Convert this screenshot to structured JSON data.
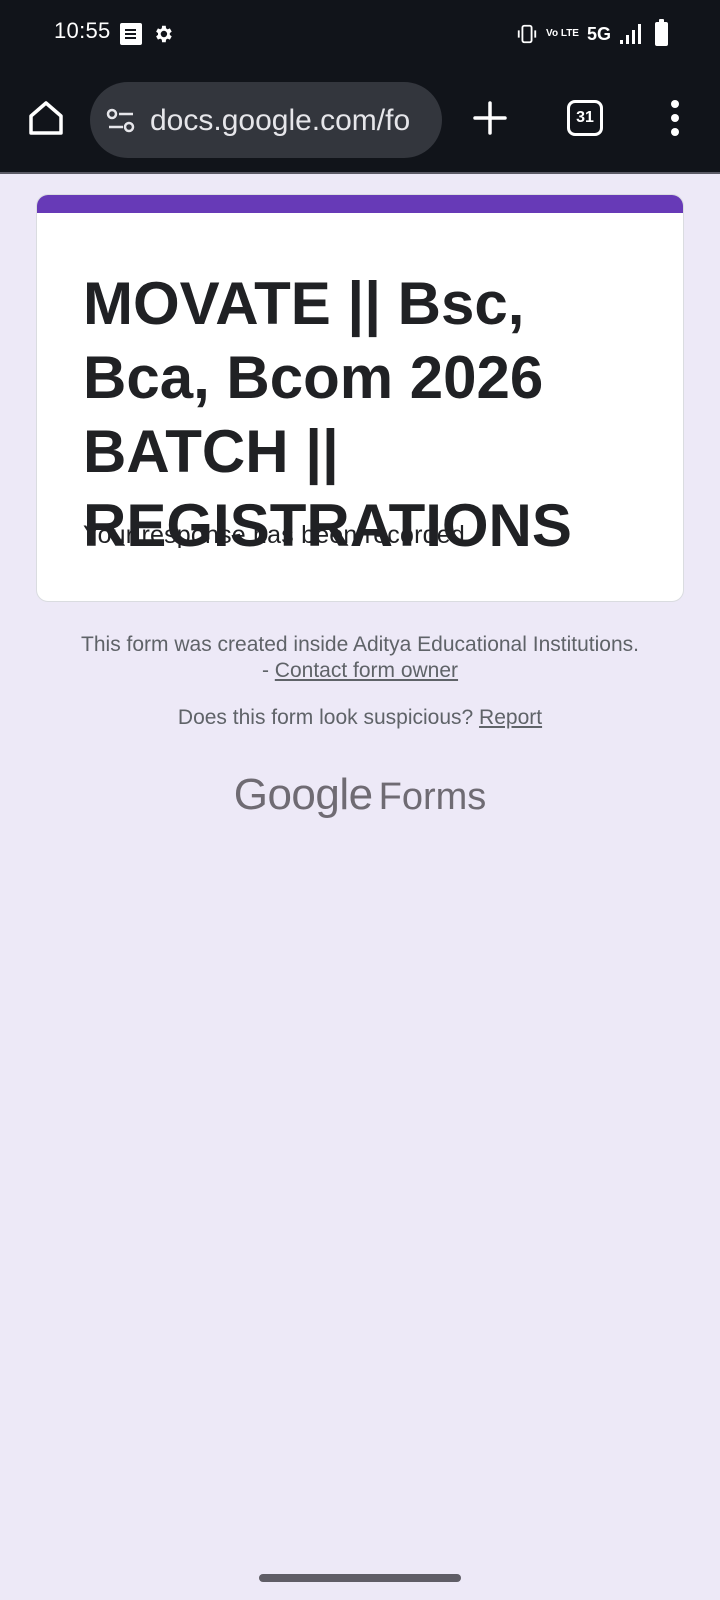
{
  "status_bar": {
    "time": "10:55",
    "volte_label": "Vo LTE",
    "network": "5G"
  },
  "browser": {
    "url": "docs.google.com/fo",
    "tab_count": "31"
  },
  "form": {
    "title": "MOVATE || Bsc, Bca, Bcom 2026 BATCH || REGISTRATIONS",
    "confirmation": "Your response has been recorded",
    "accent_color": "#673ab7"
  },
  "footer": {
    "created_inside": "This form was created inside Aditya Educational Institutions. -",
    "contact_link": "Contact form owner",
    "suspicious_text": "Does this form look suspicious?",
    "report_link": "Report",
    "logo_google": "Google",
    "logo_forms": "Forms"
  },
  "icons": {
    "home": "home-icon",
    "site_info": "site-info-icon",
    "new_tab": "plus-icon",
    "menu": "more-vert-icon"
  }
}
